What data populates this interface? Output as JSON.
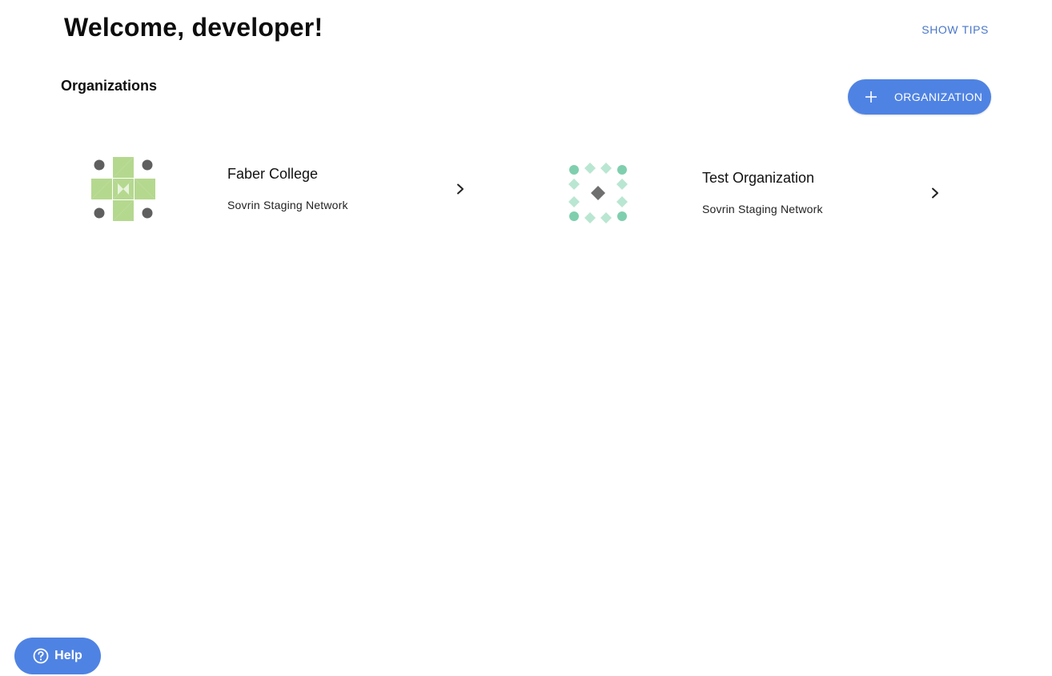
{
  "header": {
    "welcome": "Welcome, developer!",
    "show_tips": "SHOW TIPS"
  },
  "organizations": {
    "title": "Organizations",
    "add_button_label": "ORGANIZATION",
    "add_button_icon": "plus-icon",
    "items": [
      {
        "name": "Faber College",
        "network": "Sovrin Staging Network",
        "logo_icon": "identicon-pinwheel",
        "logo_color": "#b5d88f",
        "logo_accent": "#5f5f5f",
        "chevron_icon": "chevron-right-icon"
      },
      {
        "name": "Test Organization",
        "network": "Sovrin Staging Network",
        "logo_icon": "identicon-diamonds",
        "logo_color": "#b9e6d2",
        "logo_accent": "#6f6f6f",
        "chevron_icon": "chevron-right-icon"
      }
    ]
  },
  "help": {
    "label": "Help",
    "icon": "question-circle-icon"
  },
  "colors": {
    "accent": "#4f83e3",
    "link": "#4a77c9"
  }
}
